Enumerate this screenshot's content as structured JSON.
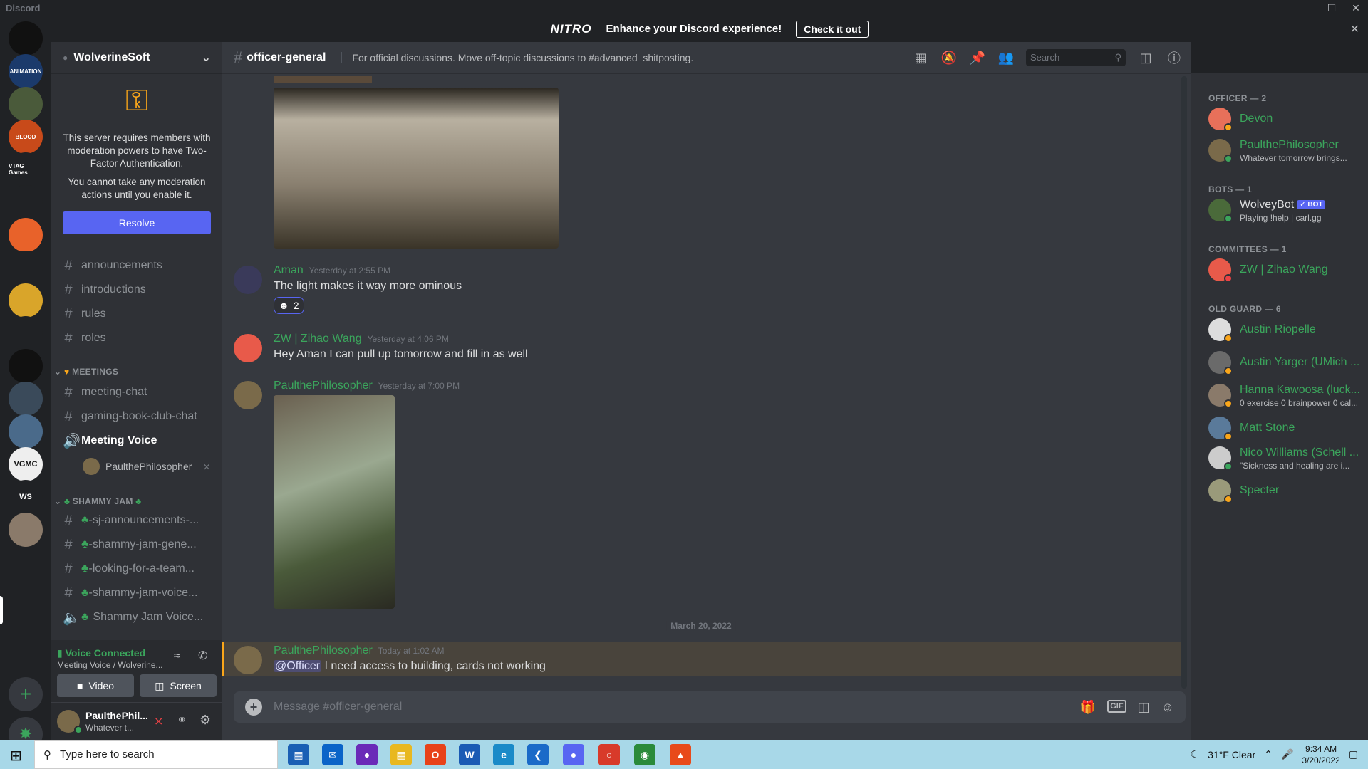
{
  "app": {
    "title": "Discord"
  },
  "nitro": {
    "logo": "NITRO",
    "text": "Enhance your Discord experience!",
    "cta": "Check it out"
  },
  "guilds": [
    {
      "name": "guild-1",
      "color": "#111"
    },
    {
      "name": "MICHIGAN ANIMATION CLUB",
      "color": "#1b3a6b",
      "label": "ANIMATION"
    },
    {
      "name": "guild-3",
      "color": "#4a5a3a"
    },
    {
      "name": "guild-4",
      "color": "#c84a1a",
      "label": "BLOOD"
    },
    {
      "name": "guild-5",
      "color": "#202225",
      "label": "VTAG Games"
    },
    {
      "name": "guild-6",
      "color": "#202225"
    },
    {
      "name": "guild-7",
      "color": "#e8622a"
    },
    {
      "name": "guild-8",
      "color": "#202225"
    },
    {
      "name": "guild-9",
      "color": "#d9a52a"
    },
    {
      "name": "guild-10",
      "color": "#202225"
    },
    {
      "name": "guild-11",
      "color": "#111"
    },
    {
      "name": "guild-12",
      "color": "#3a4a5a"
    },
    {
      "name": "guild-13",
      "color": "#4a6a8a"
    },
    {
      "name": "VGMC",
      "color": "#eee",
      "label": "VGMC"
    },
    {
      "name": "WolverineSoft",
      "color": "#202225",
      "label": "WS"
    },
    {
      "name": "guild-16",
      "color": "#8a7a6a"
    }
  ],
  "sidebar": {
    "server_name": "WolverineSoft",
    "tfa_text_1": "This server requires members with moderation powers to have Two-Factor Authentication.",
    "tfa_text_2": "You cannot take any moderation actions until you enable it.",
    "resolve": "Resolve",
    "channels": [
      "announcements",
      "introductions",
      "rules",
      "roles"
    ],
    "meetings_cat": "MEETINGS",
    "meetings": [
      "meeting-chat",
      "gaming-book-club-chat"
    ],
    "meeting_voice": "Meeting Voice",
    "voice_user": "PaulthePhilosopher",
    "shammy_cat": "SHAMMY JAM",
    "shammy": [
      "-sj-announcements-...",
      "-shammy-jam-gene...",
      "-looking-for-a-team...",
      "-shammy-jam-voice..."
    ],
    "shammy_voice": "Shammy Jam Voice...",
    "voice_connected": "Voice Connected",
    "voice_sub": "Meeting Voice / Wolverine...",
    "video": "Video",
    "screen": "Screen",
    "user_name": "PaulthePhil...",
    "user_status": "Whatever t..."
  },
  "channel": {
    "name": "officer-general",
    "topic": "For official discussions. Move off-topic discussions to #advanced_shitposting.",
    "search": "Search"
  },
  "messages": [
    {
      "author": "Aman",
      "time": "Yesterday at 2:55 PM",
      "text": "The light makes it way more ominous",
      "reaction": "2"
    },
    {
      "author": "ZW | Zihao Wang",
      "time": "Yesterday at 4:06 PM",
      "text": "Hey Aman I can pull up tomorrow and fill in as well"
    },
    {
      "author": "PaulthePhilosopher",
      "time": "Yesterday at 7:00 PM"
    },
    {
      "author": "PaulthePhilosopher",
      "time": "Today at 1:02 AM",
      "mention": "@Officer",
      "text": " I need access to building, cards not working"
    }
  ],
  "date_divider": "March 20, 2022",
  "composer": {
    "placeholder": "Message #officer-general",
    "gif": "GIF"
  },
  "members": {
    "officer_cat": "OFFICER — 2",
    "officers": [
      {
        "name": "Devon",
        "status": "",
        "color": "#3ba55c"
      },
      {
        "name": "PaulthePhilosopher",
        "status": "Whatever tomorrow brings...",
        "color": "#3ba55c"
      }
    ],
    "bots_cat": "BOTS — 1",
    "bot": {
      "name": "WolveyBot",
      "badge": "✓ BOT",
      "status": "Playing !help | carl.gg"
    },
    "committees_cat": "COMMITTEES — 1",
    "committee": {
      "name": "ZW | Zihao Wang"
    },
    "old_cat": "OLD GUARD — 6",
    "old": [
      {
        "name": "Austin Riopelle",
        "status": ""
      },
      {
        "name": "Austin Yarger (UMich ...",
        "status": ""
      },
      {
        "name": "Hanna Kawoosa (luck...",
        "status": "0 exercise 0 brainpower 0 cal..."
      },
      {
        "name": "Matt Stone",
        "status": ""
      },
      {
        "name": "Nico Williams (Schell ...",
        "status": "\"Sickness and healing are i..."
      },
      {
        "name": "Specter",
        "status": ""
      }
    ]
  },
  "taskbar": {
    "search": "Type here to search",
    "weather": "31°F  Clear",
    "time": "9:34 AM",
    "date": "3/20/2022"
  }
}
